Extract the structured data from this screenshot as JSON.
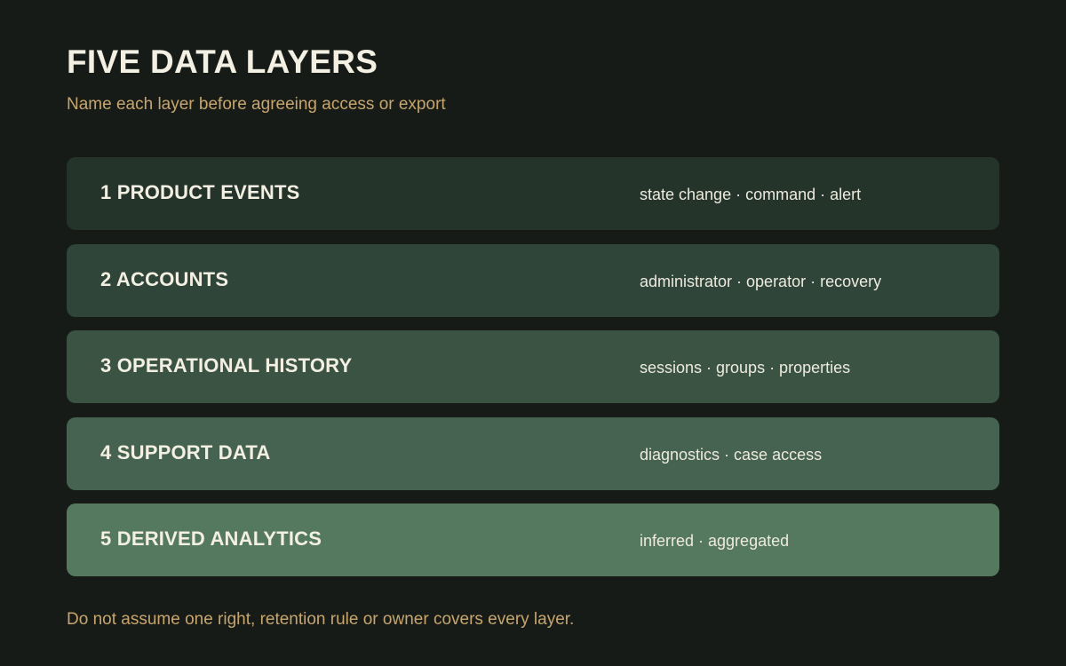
{
  "title": "FIVE DATA LAYERS",
  "subtitle": "Name each layer before agreeing access or export",
  "layers": [
    {
      "name": "1 PRODUCT EVENTS",
      "items": "state change · command · alert",
      "color": "#24342b"
    },
    {
      "name": "2 ACCOUNTS",
      "items": "administrator · operator · recovery",
      "color": "#2f4539"
    },
    {
      "name": "3 OPERATIONAL HISTORY",
      "items": "sessions · groups · properties",
      "color": "#3a5343"
    },
    {
      "name": "4 SUPPORT DATA",
      "items": "diagnostics · case access",
      "color": "#466250"
    },
    {
      "name": "5 DERIVED ANALYTICS",
      "items": "inferred · aggregated",
      "color": "#54795f"
    }
  ],
  "footer": "Do not assume one right, retention rule or owner covers every layer."
}
